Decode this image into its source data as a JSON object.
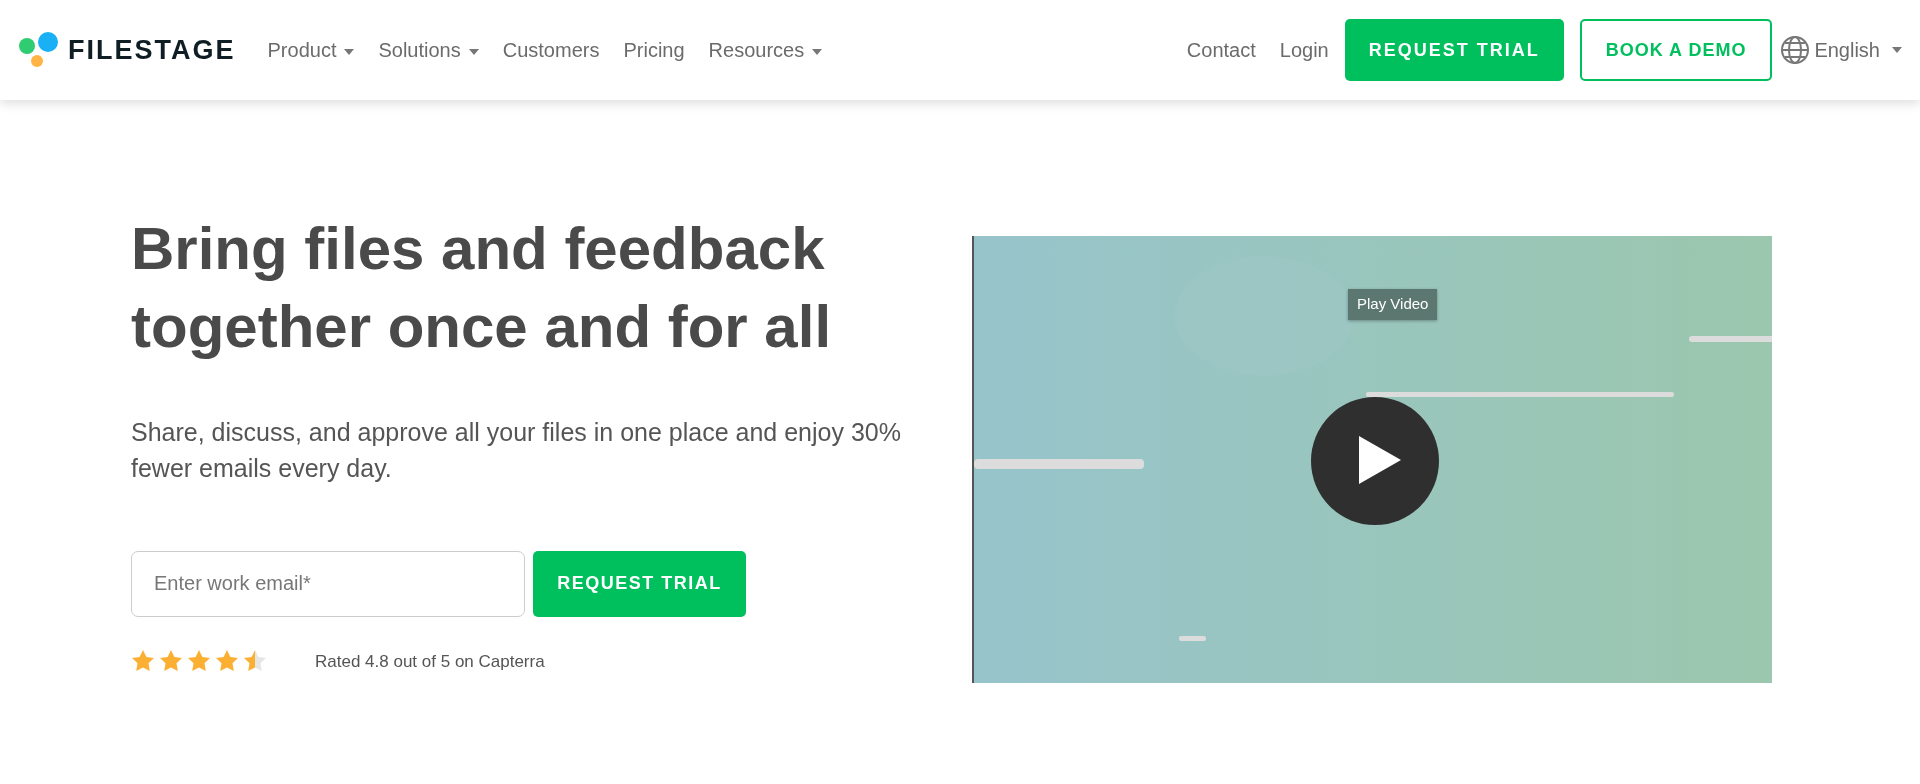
{
  "header": {
    "logo_text": "FILESTAGE",
    "nav": [
      {
        "label": "Product",
        "dropdown": true
      },
      {
        "label": "Solutions",
        "dropdown": true
      },
      {
        "label": "Customers",
        "dropdown": false
      },
      {
        "label": "Pricing",
        "dropdown": false
      },
      {
        "label": "Resources",
        "dropdown": true
      }
    ],
    "right_links": [
      "Contact",
      "Login"
    ],
    "trial_button": "REQUEST TRIAL",
    "demo_button": "BOOK A DEMO",
    "language": "English"
  },
  "hero": {
    "headline": "Bring files and feedback together once and for all",
    "subtitle": "Share, discuss, and approve all your files in one place and enjoy 30% fewer emails every day.",
    "email": {
      "placeholder": "Enter work email*"
    },
    "cta_button": "REQUEST TRIAL",
    "rating": {
      "stars": 4.5,
      "text": "Rated 4.8 out of 5 on Capterra"
    }
  },
  "video": {
    "tooltip": "Play Video"
  }
}
